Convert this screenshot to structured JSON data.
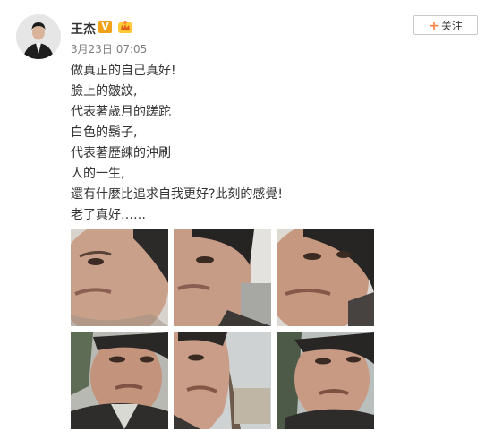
{
  "user": {
    "name": "王杰",
    "verified_badge": "V",
    "badges": [
      "verified-v-icon",
      "crown-member-icon"
    ],
    "post_time": "3月23日 07:05"
  },
  "follow_button": {
    "icon": "plus-icon",
    "label": "关注"
  },
  "post": {
    "lines": [
      "做真正的自己真好!",
      "臉上的皺紋,",
      "代表著歲月的蹉跎",
      "白色的鬍子,",
      "代表著歷練的沖刷",
      "人的一生,",
      "還有什麼比追求自我更好?此刻的感覺!",
      "老了真好……"
    ]
  },
  "photos": [
    {
      "name": "selfie-photo-1",
      "bg": "#d8d3cc",
      "face": "#c9a08a"
    },
    {
      "name": "selfie-photo-2",
      "bg": "#e4e2de",
      "face": "#c79c86"
    },
    {
      "name": "selfie-photo-3",
      "bg": "#dcd8d2",
      "face": "#c6987f"
    },
    {
      "name": "selfie-photo-4",
      "bg": "#b7b9b2",
      "face": "#c4937c"
    },
    {
      "name": "selfie-photo-5",
      "bg": "#cfd2d3",
      "face": "#c99d88"
    },
    {
      "name": "selfie-photo-6",
      "bg": "#b9bfbd",
      "face": "#c89a84"
    }
  ],
  "colors": {
    "accent": "#ff8140",
    "vip": "#f0a117",
    "text": "#333333",
    "muted": "#808080"
  }
}
